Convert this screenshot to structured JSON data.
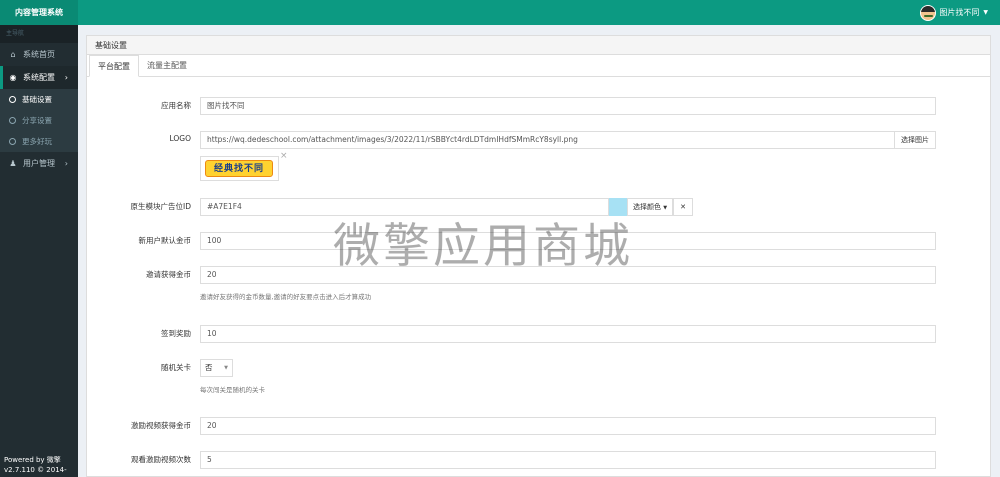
{
  "app": {
    "title": "内容管理系统"
  },
  "user": {
    "name": "图片找不同"
  },
  "sidebar": {
    "header": "主导航",
    "items": [
      {
        "label": "系统首页",
        "icon": "home-icon"
      },
      {
        "label": "系统配置",
        "icon": "dashboard-icon"
      },
      {
        "label": "用户管理",
        "icon": "users-icon"
      }
    ],
    "subitems": [
      {
        "label": "基础设置"
      },
      {
        "label": "分享设置"
      },
      {
        "label": "更多好玩"
      }
    ],
    "footer_line1": "Powered by 微擎",
    "footer_line2": "v2.7.110 © 2014-"
  },
  "panel": {
    "title": "基础设置",
    "tabs": [
      {
        "label": "平台配置"
      },
      {
        "label": "流量主配置"
      }
    ]
  },
  "form": {
    "app_name": {
      "label": "应用名称",
      "value": "图片找不同"
    },
    "logo": {
      "label": "LOGO",
      "value": "https://wq.dedeschool.com/attachment/images/3/2022/11/rSBBYct4rdLDTdmIHdfSMmRcY8syll.png",
      "button": "选择图片",
      "thumb_text": "经典找不同"
    },
    "ad_unit": {
      "label": "原生模块广告位ID",
      "value": "#A7E1F4",
      "color": "#A7E1F4",
      "button": "选择颜色",
      "clear": "✕"
    },
    "new_user_coins": {
      "label": "新用户默认金币",
      "value": "100"
    },
    "invite_coins": {
      "label": "邀请获得金币",
      "value": "20",
      "help": "邀请好友获得的金币数量,邀请的好友要点击进入后才算成功"
    },
    "checkin_reward": {
      "label": "签到奖励",
      "value": "10"
    },
    "random_level": {
      "label": "随机关卡",
      "value": "否",
      "help": "每次闯关是随机的关卡"
    },
    "video_coins": {
      "label": "激励视频获得金币",
      "value": "20"
    },
    "video_views": {
      "label": "观看激励视频次数",
      "value": "5"
    }
  },
  "watermark": "微擎应用商城"
}
